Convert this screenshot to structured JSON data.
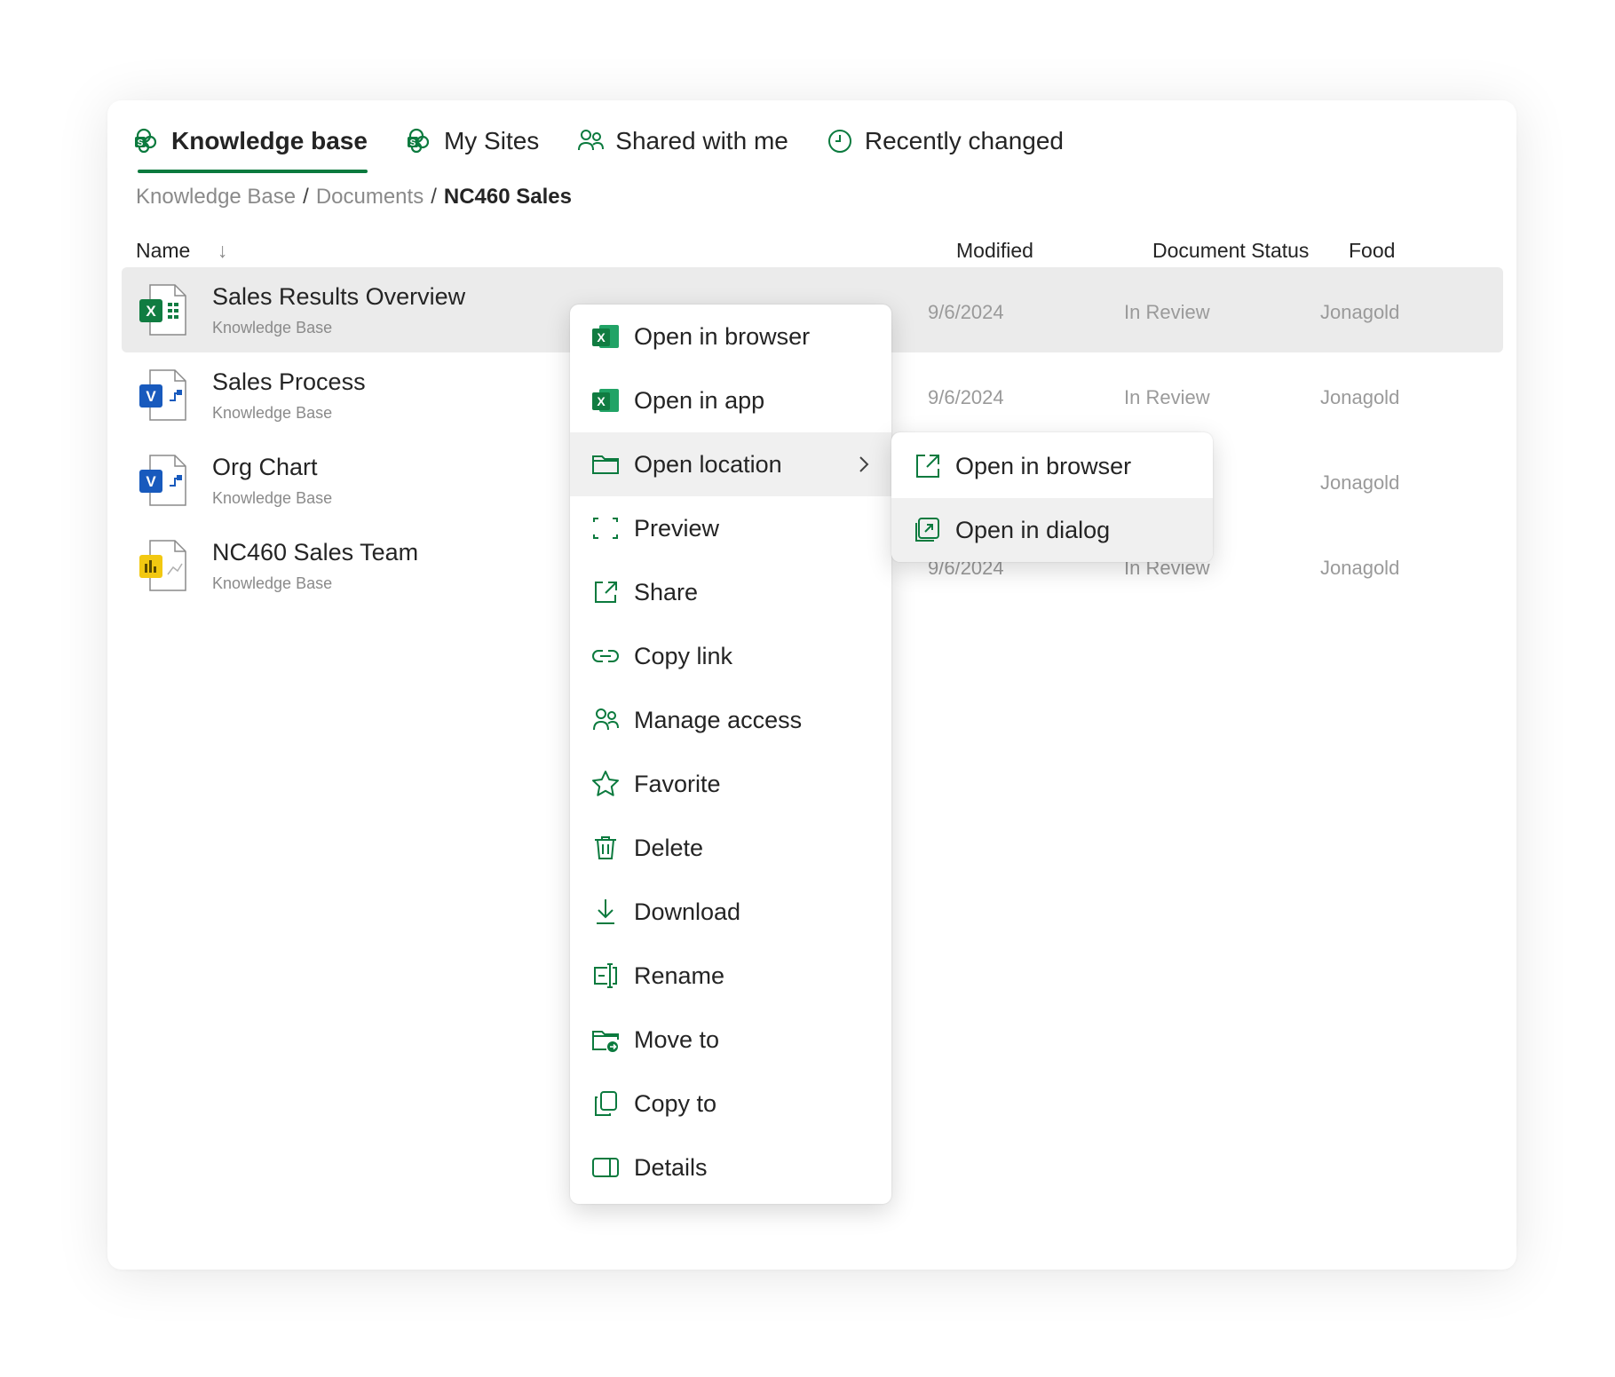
{
  "tabs": [
    {
      "label": "Knowledge base",
      "icon": "sharepoint-icon",
      "active": true
    },
    {
      "label": "My Sites",
      "icon": "sharepoint-icon",
      "active": false
    },
    {
      "label": "Shared with me",
      "icon": "people-icon",
      "active": false
    },
    {
      "label": "Recently changed",
      "icon": "clock-icon",
      "active": false
    }
  ],
  "breadcrumb": {
    "items": [
      "Knowledge Base",
      "Documents",
      "NC460 Sales"
    ],
    "separator": "/"
  },
  "table": {
    "headers": {
      "name": "Name",
      "sort_arrow": "↓",
      "modified": "Modified",
      "status": "Document Status",
      "food": "Food"
    },
    "rows": [
      {
        "name": "Sales Results Overview",
        "location": "Knowledge Base",
        "modified": "9/6/2024",
        "status": "In Review",
        "food": "Jonagold",
        "icon": "excel-file-icon",
        "selected": true
      },
      {
        "name": "Sales Process",
        "location": "Knowledge Base",
        "modified": "9/6/2024",
        "status": "In Review",
        "food": "Jonagold",
        "icon": "visio-file-icon"
      },
      {
        "name": "Org Chart",
        "location": "Knowledge Base",
        "modified": "",
        "status": "",
        "food": "Jonagold",
        "icon": "visio-file-icon"
      },
      {
        "name": "NC460 Sales Team",
        "location": "Knowledge Base",
        "modified": "9/6/2024",
        "status": "In Review",
        "food": "Jonagold",
        "icon": "powerbi-file-icon"
      }
    ]
  },
  "context_menu": {
    "items": [
      {
        "label": "Open in browser",
        "icon": "excel-icon"
      },
      {
        "label": "Open in app",
        "icon": "excel-icon"
      },
      {
        "label": "Open location",
        "icon": "folder-icon",
        "has_submenu": true
      },
      {
        "label": "Preview",
        "icon": "preview-icon"
      },
      {
        "label": "Share",
        "icon": "share-icon"
      },
      {
        "label": "Copy link",
        "icon": "link-icon"
      },
      {
        "label": "Manage access",
        "icon": "people-icon"
      },
      {
        "label": "Favorite",
        "icon": "star-icon"
      },
      {
        "label": "Delete",
        "icon": "trash-icon"
      },
      {
        "label": "Download",
        "icon": "download-icon"
      },
      {
        "label": "Rename",
        "icon": "rename-icon"
      },
      {
        "label": "Move to",
        "icon": "folder-move-icon"
      },
      {
        "label": "Copy to",
        "icon": "copy-icon"
      },
      {
        "label": "Details",
        "icon": "details-pane-icon"
      }
    ]
  },
  "submenu": {
    "items": [
      {
        "label": "Open in browser",
        "icon": "open-external-icon"
      },
      {
        "label": "Open in dialog",
        "icon": "open-dialog-icon"
      }
    ]
  },
  "colors": {
    "accent": "#0b7a3e",
    "excel": "#107c41",
    "visio": "#185abd",
    "powerbi": "#f2c811"
  }
}
